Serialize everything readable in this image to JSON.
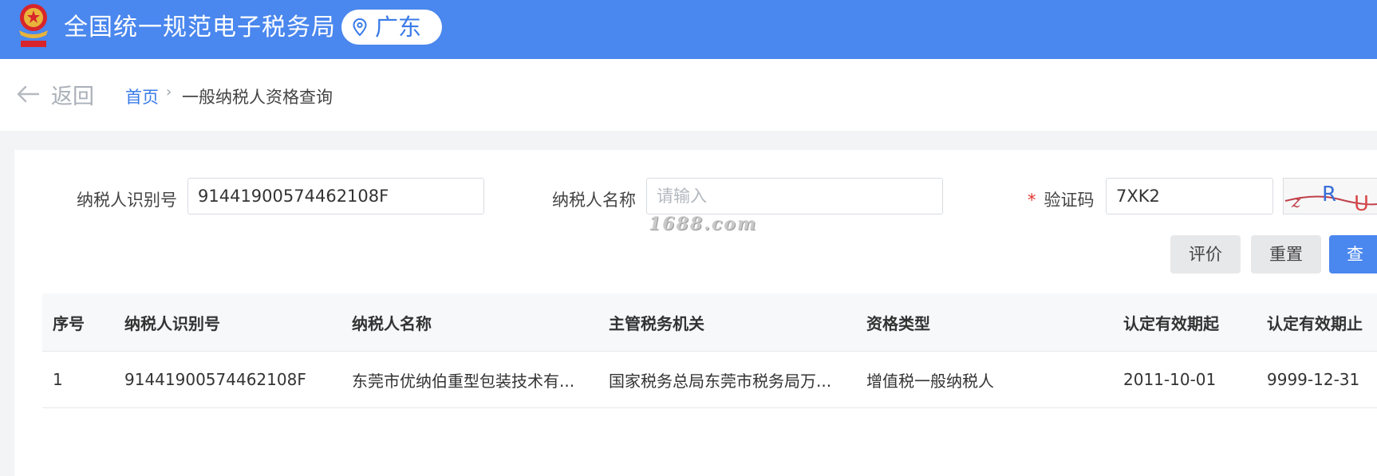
{
  "header": {
    "site_title": "全国统一规范电子税务局",
    "region": "广东",
    "emblem_icon": "national-tax-emblem",
    "colors": {
      "brand_blue": "#4a87ee",
      "accent_text": "#3a7be8",
      "required": "#e0362c"
    }
  },
  "nav": {
    "back_label": "返回",
    "breadcrumb": {
      "home": "首页",
      "separator": "›",
      "current": "一般纳税人资格查询"
    }
  },
  "form": {
    "taxpayer_id": {
      "label": "纳税人识别号",
      "value": "91441900574462108F"
    },
    "taxpayer_name": {
      "label": "纳税人名称",
      "placeholder": "请输入"
    },
    "captcha": {
      "required_mark": "*",
      "label": "验证码",
      "value": "7XK2",
      "image_text": "zRU"
    },
    "buttons": {
      "rate": "评价",
      "reset": "重置",
      "query": "查询"
    },
    "watermark": "1688.com"
  },
  "table": {
    "columns": [
      "序号",
      "纳税人识别号",
      "纳税人名称",
      "主管税务机关",
      "资格类型",
      "认定有效期起",
      "认定有效期止"
    ],
    "rows": [
      [
        "1",
        "91441900574462108F",
        "东莞市优纳伯重型包装技术有...",
        "国家税务总局东莞市税务局万...",
        "增值税一般纳税人",
        "2011-10-01",
        "9999-12-31"
      ]
    ]
  }
}
